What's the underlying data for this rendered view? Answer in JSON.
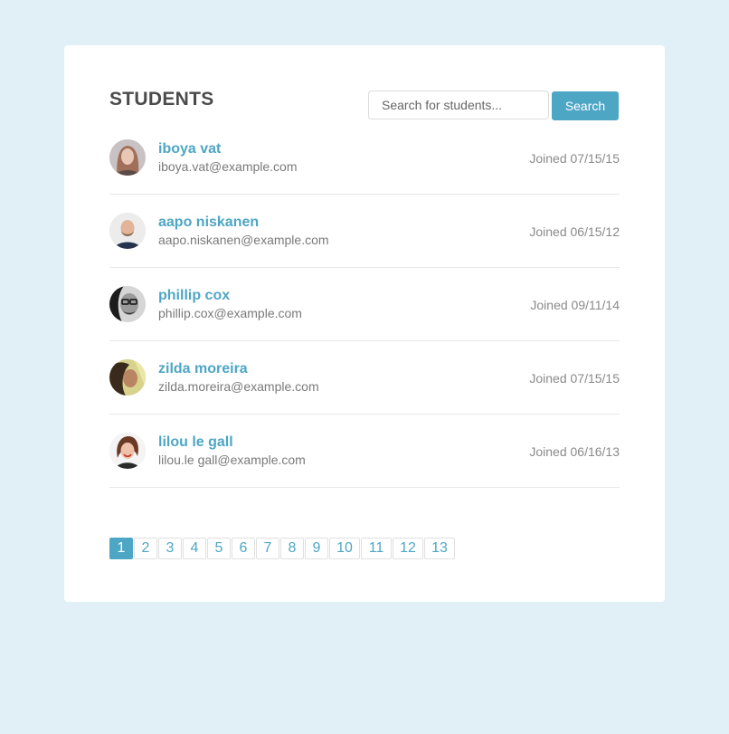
{
  "header": {
    "title": "STUDENTS",
    "search_placeholder": "Search for students...",
    "search_button": "Search"
  },
  "students": [
    {
      "name": "iboya vat",
      "email": "iboya.vat@example.com",
      "joined": "Joined 07/15/15"
    },
    {
      "name": "aapo niskanen",
      "email": "aapo.niskanen@example.com",
      "joined": "Joined 06/15/12"
    },
    {
      "name": "phillip cox",
      "email": "phillip.cox@example.com",
      "joined": "Joined 09/11/14"
    },
    {
      "name": "zilda moreira",
      "email": "zilda.moreira@example.com",
      "joined": "Joined 07/15/15"
    },
    {
      "name": "lilou le gall",
      "email": "lilou.le gall@example.com",
      "joined": "Joined 06/16/13"
    }
  ],
  "pagination": {
    "pages": [
      "1",
      "2",
      "3",
      "4",
      "5",
      "6",
      "7",
      "8",
      "9",
      "10",
      "11",
      "12",
      "13"
    ],
    "current": "1"
  },
  "colors": {
    "background": "#e1f0f6",
    "accent": "#4ea6c5",
    "title": "#4b4b4b"
  }
}
